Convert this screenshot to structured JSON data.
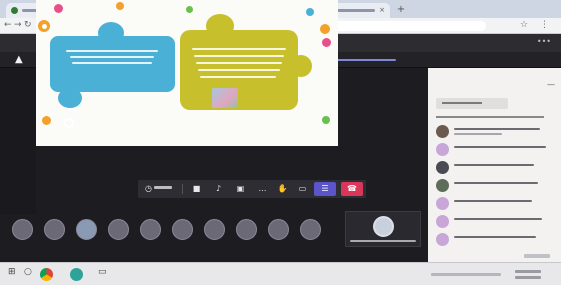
{
  "browser": {
    "tabs": [
      {
        "label": "",
        "favicon_color": "#2f7d32"
      },
      {
        "label": "",
        "favicon_color": "#5b55c9"
      },
      {
        "label": "",
        "favicon_color": "#2b6fd6"
      }
    ],
    "new_tab_glyph": "+",
    "url": ""
  },
  "meeting": {
    "app_title": "",
    "search_placeholder": ""
  },
  "banner": {
    "warning_icon": "warning-icon",
    "strong_text": "",
    "dismiss": ""
  },
  "stage": {
    "presenter_label": "",
    "slide": {
      "blue_piece_text": "",
      "yellow_piece_title": "",
      "colors": {
        "blue": "#4ab0d6",
        "yellow": "#c8bf2c"
      }
    }
  },
  "controls": {
    "timer": "",
    "icons": [
      "camera-icon",
      "mic-icon",
      "share-screen-icon",
      "more-icon",
      "raise-hand-icon",
      "chat-icon",
      "participants-icon",
      "hangup-icon"
    ],
    "hangup_color": "#d9365a",
    "accent_color": "#5b55c9"
  },
  "participants": {
    "initials": [
      "",
      "",
      "",
      "",
      "",
      "",
      "",
      "",
      "",
      ""
    ]
  },
  "self_tile": {
    "name": ""
  },
  "people_panel": {
    "title": "",
    "invite_button": "",
    "section_label": "",
    "entries": [
      {
        "name": ""
      },
      {
        "name": ""
      },
      {
        "name": ""
      },
      {
        "name": ""
      },
      {
        "name": ""
      },
      {
        "name": ""
      },
      {
        "name": ""
      },
      {
        "name": ""
      }
    ]
  },
  "taskbar": {
    "items": [
      "start-icon",
      "search-icon",
      "chrome-icon",
      "teams-icon",
      "explorer-icon"
    ]
  }
}
